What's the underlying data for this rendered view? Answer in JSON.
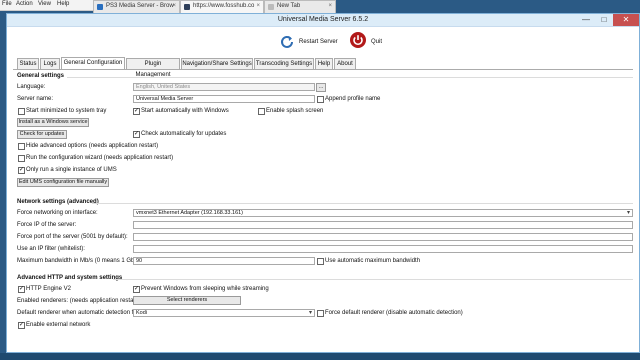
{
  "host_menu": [
    "File",
    "Action",
    "View",
    "Help"
  ],
  "browser_tabs": [
    {
      "label": "PS3 Media Server - Brow",
      "color": "#2a6fbf"
    },
    {
      "label": "https://www.fosshub.co",
      "color": "#2f3f5a"
    },
    {
      "label": "New Tab",
      "color": "#9a9a9a"
    }
  ],
  "window": {
    "title": "Universal Media Server 6.5.2",
    "min": "—",
    "max": "□",
    "close": "✕"
  },
  "toolbar": {
    "restart_label": "Restart Server",
    "quit_label": "Quit"
  },
  "tabs": [
    "Status",
    "Logs",
    "General Configuration",
    "Plugin Management",
    "Navigation/Share Settings",
    "Transcoding Settings",
    "Help",
    "About"
  ],
  "general": {
    "header": "General settings",
    "language_label": "Language:",
    "language_value": "English, United States",
    "language_button": "...",
    "server_name_label": "Server name:",
    "server_name_value": "Universal Media Server",
    "append_profile_label": "Append profile name",
    "start_minimized_label": "Start minimized to system tray",
    "start_windows_label": "Start automatically with Windows",
    "splash_label": "Enable splash screen",
    "install_service_button": "Install as a Windows service",
    "check_updates_button": "Check for updates",
    "check_auto_label": "Check automatically for updates",
    "hide_advanced_label": "Hide advanced options (needs application restart)",
    "run_wizard_label": "Run the configuration wizard (needs application restart)",
    "single_instance_label": "Only run a single instance of UMS",
    "edit_conf_button": "Edit UMS configuration file manually"
  },
  "network": {
    "header": "Network settings (advanced)",
    "force_interface_label": "Force networking on interface:",
    "force_interface_value": "vmxnet3 Ethernet Adapter (192.168.33.161)",
    "force_ip_label": "Force IP of the server:",
    "force_port_label": "Force port of the server (5001 by default):",
    "ip_filter_label": "Use an IP filter (whitelist):",
    "max_bandwidth_label": "Maximum bandwidth in Mb/s (0 means 1 Gb/s):",
    "max_bandwidth_value": "90",
    "auto_bandwidth_label": "Use automatic maximum bandwidth"
  },
  "advanced": {
    "header": "Advanced HTTP and system settings",
    "http_engine_label": "HTTP Engine V2",
    "prevent_sleep_label": "Prevent Windows from sleeping while streaming",
    "enabled_renderers_label": "Enabled renderers: (needs application restart)",
    "select_renderers_button": "Select renderers",
    "default_renderer_label": "Default renderer when automatic detection fails:",
    "default_renderer_value": "Kodi",
    "force_default_label": "Force default renderer (disable automatic detection)",
    "external_network_label": "Enable external network"
  },
  "colors": {
    "accent": "#dcecf8",
    "quit": "#b21a1a",
    "restart": "#2f6db3"
  }
}
